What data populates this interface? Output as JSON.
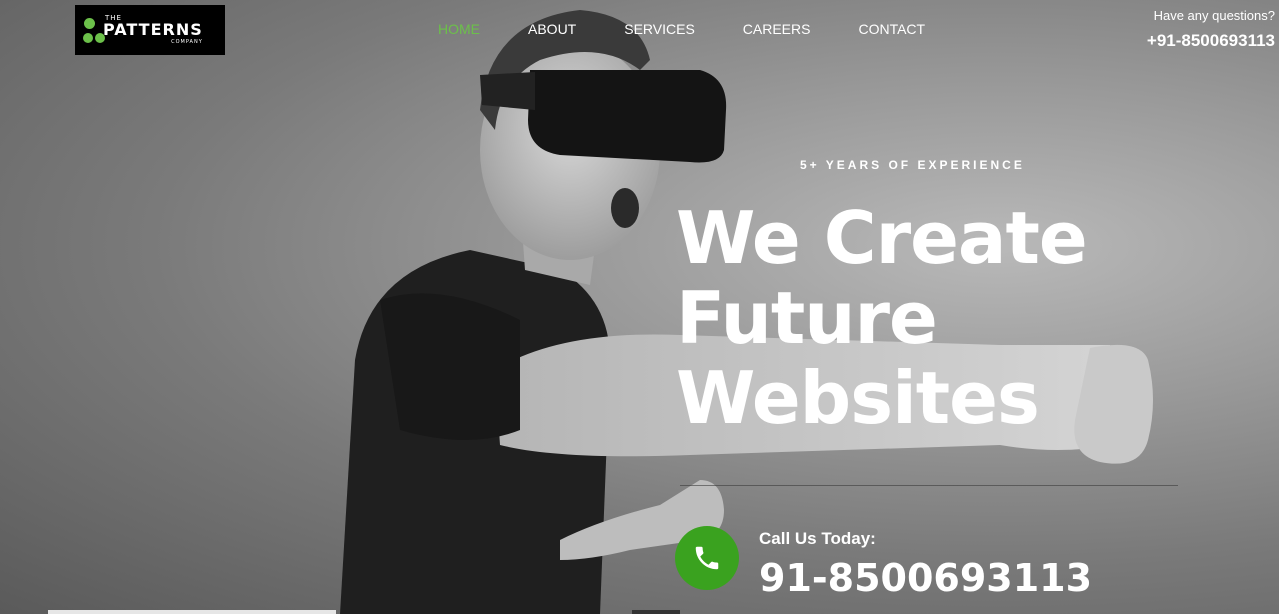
{
  "logo": {
    "the": "THE",
    "name": "PATTERNS",
    "company": "COMPANY"
  },
  "nav": [
    {
      "label": "HOME",
      "active": true
    },
    {
      "label": "ABOUT",
      "active": false
    },
    {
      "label": "SERVICES",
      "active": false
    },
    {
      "label": "CAREERS",
      "active": false
    },
    {
      "label": "CONTACT",
      "active": false
    }
  ],
  "contact_top": {
    "question": "Have any questions?",
    "phone": "+91-8500693113"
  },
  "hero": {
    "tagline": "5+ YEARS OF EXPERIENCE",
    "line1": "We Create",
    "line2": "Future",
    "line3": "Websites"
  },
  "call": {
    "label": "Call Us Today:",
    "number": "91-8500693113",
    "icon": "phone-icon"
  },
  "colors": {
    "accent": "#6cc04a",
    "call_button": "#3aa21f"
  }
}
